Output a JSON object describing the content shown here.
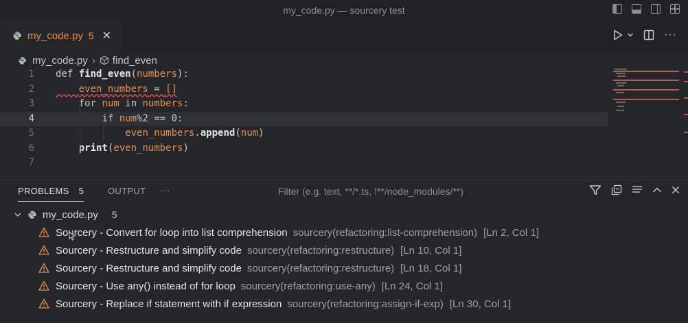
{
  "window": {
    "title": "my_code.py — sourcery test"
  },
  "tab": {
    "name": "my_code.py",
    "count": "5",
    "close": "✕"
  },
  "breadcrumb": {
    "file": "my_code.py",
    "symbol": "find_even"
  },
  "editor": {
    "line_numbers": [
      "1",
      "2",
      "3",
      "4",
      "5",
      "6",
      "7"
    ],
    "active_line": "4"
  },
  "panel": {
    "tabs": {
      "problems": "PROBLEMS",
      "problems_count": "5",
      "output": "OUTPUT",
      "more": "···"
    },
    "filter_placeholder": "Filter (e.g. text, **/*.ts, !**/node_modules/**)",
    "file": {
      "name": "my_code.py",
      "count": "5"
    },
    "problems": [
      {
        "message": "Sourcery - Convert for loop into list comprehension",
        "source": "sourcery(refactoring:list-comprehension)",
        "location": "[Ln 2, Col 1]"
      },
      {
        "message": "Sourcery - Restructure and simplify code",
        "source": "sourcery(refactoring:restructure)",
        "location": "[Ln 10, Col 1]"
      },
      {
        "message": "Sourcery - Restructure and simplify code",
        "source": "sourcery(refactoring:restructure)",
        "location": "[Ln 18, Col 1]"
      },
      {
        "message": "Sourcery - Use any() instead of for loop",
        "source": "sourcery(refactoring:use-any)",
        "location": "[Ln 24, Col 1]"
      },
      {
        "message": "Sourcery - Replace if statement with if expression",
        "source": "sourcery(refactoring:assign-if-exp)",
        "location": "[Ln 30, Col 1]"
      }
    ]
  },
  "colors": {
    "accent": "#e8904a",
    "error": "#d9534f",
    "warning": "#e8904a"
  },
  "icons": [
    "python-file-icon",
    "symbol-method-icon",
    "run-icon",
    "split-editor-icon",
    "more-icon",
    "filter-icon",
    "collapse-all-icon",
    "view-as-list-icon",
    "maximize-panel-icon",
    "close-icon",
    "warning-icon"
  ]
}
